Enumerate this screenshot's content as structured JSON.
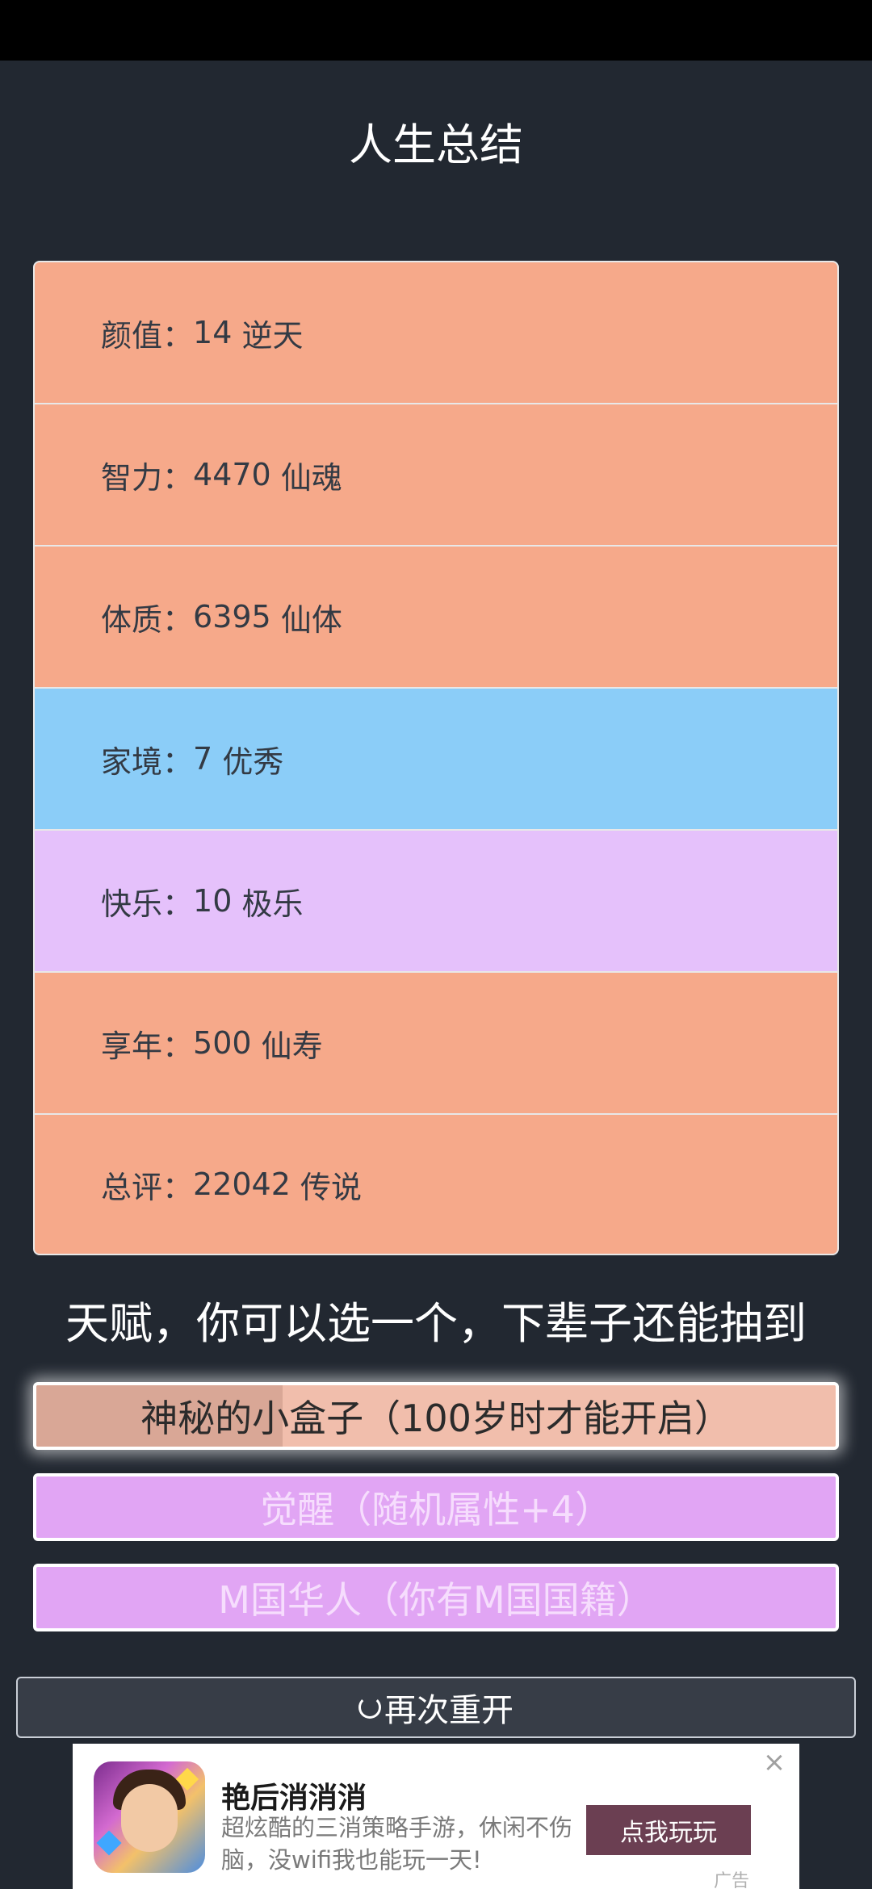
{
  "page_title": "人生总结",
  "stats": [
    {
      "label": "颜值",
      "sep": "：",
      "value": "14",
      "grade": "逆天",
      "color": "#f6a98a"
    },
    {
      "label": "智力",
      "sep": "：",
      "value": "4470",
      "grade": "仙魂",
      "color": "#f6a98a"
    },
    {
      "label": "体质",
      "sep": "：",
      "value": "6395",
      "grade": "仙体",
      "color": "#f6a98a"
    },
    {
      "label": "家境",
      "sep": "：",
      "value": "7",
      "grade": "优秀",
      "color": "#8bcdf8"
    },
    {
      "label": "快乐",
      "sep": "：",
      "value": "10",
      "grade": "极乐",
      "color": "#e5c1fb"
    },
    {
      "label": "享年",
      "sep": "：",
      "value": "500",
      "grade": "仙寿",
      "color": "#f6a98a"
    },
    {
      "label": "总评",
      "sep": "：",
      "value": "22042",
      "grade": "传说",
      "color": "#f6a98a"
    }
  ],
  "talent_title": "天赋，你可以选一个，下辈子还能抽到",
  "talents": [
    {
      "label": "神秘的小盒子（100岁时才能开启）",
      "selected": true
    },
    {
      "label": "觉醒（随机属性+4）",
      "selected": false
    },
    {
      "label": "M国华人（你有M国国籍）",
      "selected": false
    }
  ],
  "restart_label": "再次重开",
  "ad": {
    "title": "艳后消消消",
    "description": "超炫酷的三消策略手游，休闲不伤脑，没wifi我也能玩一天!",
    "button": "点我玩玩",
    "close": "×",
    "tag": "广告"
  }
}
